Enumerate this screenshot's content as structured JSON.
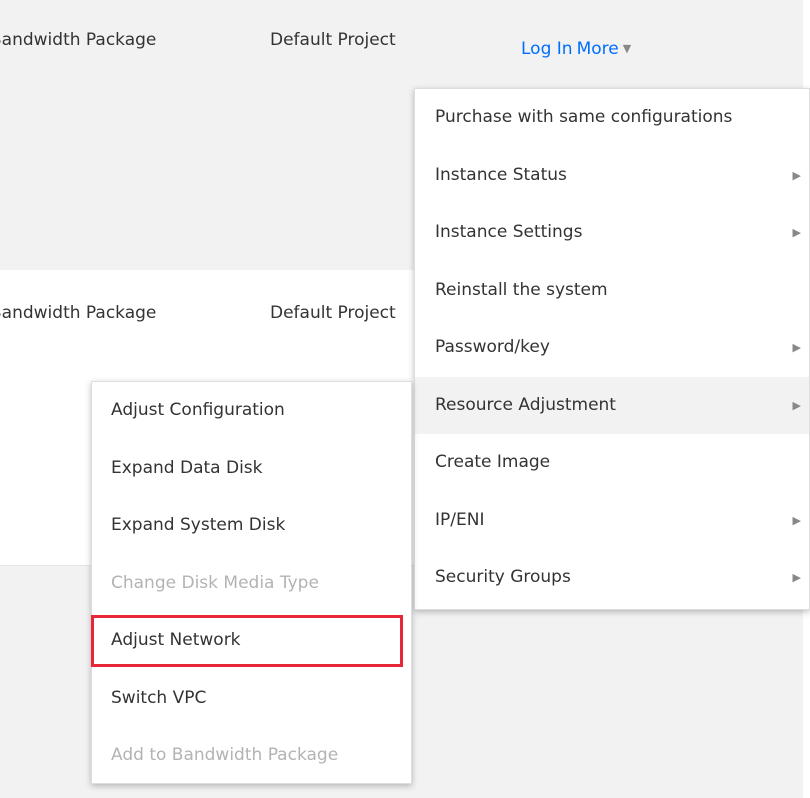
{
  "table": {
    "rows": [
      {
        "billing": "Bandwidth Package",
        "project": "Default Project"
      },
      {
        "billing": "Bandwidth Package",
        "project": "Default Project"
      }
    ],
    "operations": {
      "login": "Log In",
      "more": "More"
    }
  },
  "more_menu": {
    "items": [
      {
        "label": "Purchase with same configurations",
        "has_submenu": false
      },
      {
        "label": "Instance Status",
        "has_submenu": true
      },
      {
        "label": "Instance Settings",
        "has_submenu": true
      },
      {
        "label": "Reinstall the system",
        "has_submenu": false
      },
      {
        "label": "Password/key",
        "has_submenu": true
      },
      {
        "label": "Resource Adjustment",
        "has_submenu": true,
        "active": true
      },
      {
        "label": "Create Image",
        "has_submenu": false
      },
      {
        "label": "IP/ENI",
        "has_submenu": true
      },
      {
        "label": "Security Groups",
        "has_submenu": true
      }
    ]
  },
  "resource_submenu": {
    "items": [
      {
        "label": "Adjust Configuration",
        "disabled": false
      },
      {
        "label": "Expand Data Disk",
        "disabled": false
      },
      {
        "label": "Expand System Disk",
        "disabled": false
      },
      {
        "label": "Change Disk Media Type",
        "disabled": true
      },
      {
        "label": "Adjust Network",
        "disabled": false,
        "highlighted": true
      },
      {
        "label": "Switch VPC",
        "disabled": false
      },
      {
        "label": "Add to Bandwidth Package",
        "disabled": true
      }
    ]
  },
  "colors": {
    "link": "#006eff",
    "highlight_border": "#e8263a",
    "row_hover": "#f2f2f2",
    "disabled_text": "#b3b3b3"
  }
}
